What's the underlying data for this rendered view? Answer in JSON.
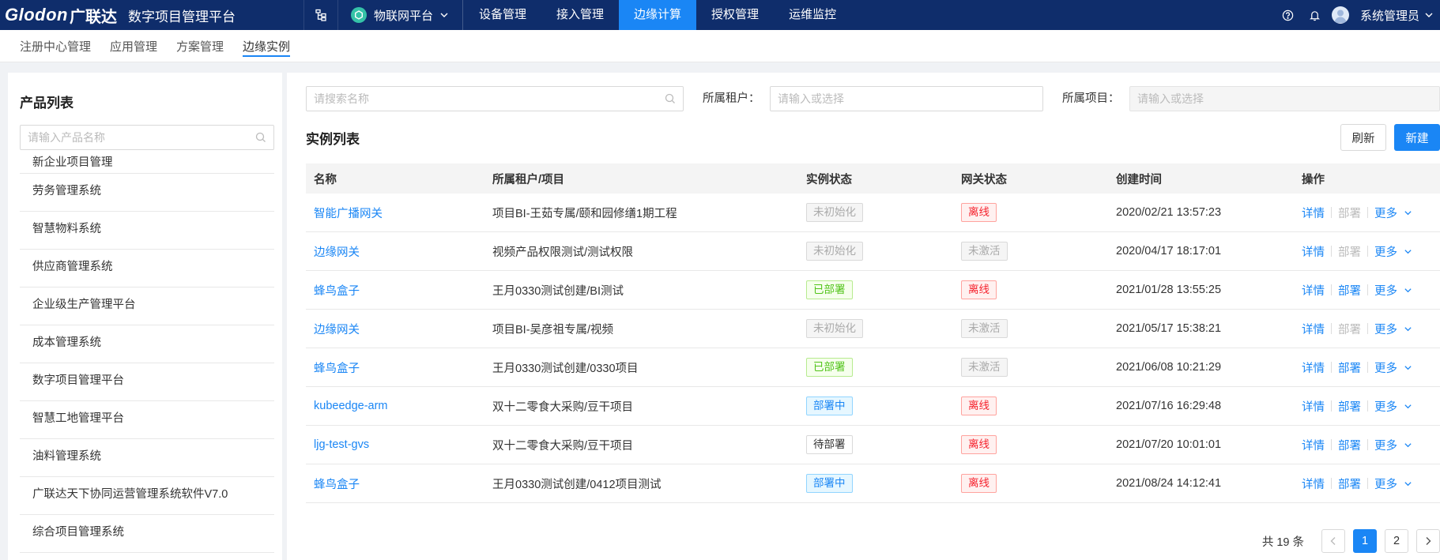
{
  "topbar": {
    "brand": "Glodon",
    "brand_cn": "广联达",
    "platform_title": "数字项目管理平台",
    "iot_menu": "物联网平台",
    "nav": [
      {
        "label": "设备管理",
        "active": false
      },
      {
        "label": "接入管理",
        "active": false
      },
      {
        "label": "边缘计算",
        "active": true
      },
      {
        "label": "授权管理",
        "active": false
      },
      {
        "label": "运维监控",
        "active": false
      }
    ],
    "icons": [
      "org-structure-icon",
      "help-icon",
      "bell-icon",
      "avatar-icon"
    ],
    "user_name": "系统管理员"
  },
  "subnav": {
    "tabs": [
      {
        "label": "注册中心管理",
        "active": false
      },
      {
        "label": "应用管理",
        "active": false
      },
      {
        "label": "方案管理",
        "active": false
      },
      {
        "label": "边缘实例",
        "active": true
      }
    ]
  },
  "left": {
    "title": "产品列表",
    "search_placeholder": "请输入产品名称",
    "products": [
      "新企业项目管理",
      "劳务管理系统",
      "智慧物料系统",
      "供应商管理系统",
      "企业级生产管理平台",
      "成本管理系统",
      "数字项目管理平台",
      "智慧工地管理平台",
      "油料管理系统",
      "广联达天下协同运营管理系统软件V7.0",
      "综合项目管理系统"
    ]
  },
  "filters": {
    "name_placeholder": "请搜索名称",
    "tenant_label": "所属租户：",
    "tenant_placeholder": "请输入或选择",
    "project_label": "所属项目：",
    "project_placeholder": "请输入或选择"
  },
  "section": {
    "title": "实例列表",
    "refresh_label": "刷新",
    "new_label": "新建"
  },
  "table": {
    "headers": [
      "名称",
      "所属租户/项目",
      "实例状态",
      "网关状态",
      "创建时间",
      "操作"
    ],
    "actions": {
      "detail": "详情",
      "deploy": "部署",
      "more": "更多"
    },
    "rows": [
      {
        "name": "智能广播网关",
        "tenant": "项目BI-王茹专属/颐和园修缮1期工程",
        "instance_status": "未初始化",
        "instance_tag": "gray",
        "gateway_status": "离线",
        "gateway_tag": "red",
        "created": "2020/02/21 13:57:23",
        "deploy_enabled": false
      },
      {
        "name": "边缘网关",
        "tenant": "视频产品权限测试/测试权限",
        "instance_status": "未初始化",
        "instance_tag": "gray",
        "gateway_status": "未激活",
        "gateway_tag": "gray",
        "created": "2020/04/17 18:17:01",
        "deploy_enabled": false
      },
      {
        "name": "蜂鸟盒子",
        "tenant": "王月0330测试创建/BI测试",
        "instance_status": "已部署",
        "instance_tag": "green",
        "gateway_status": "离线",
        "gateway_tag": "red",
        "created": "2021/01/28 13:55:25",
        "deploy_enabled": true
      },
      {
        "name": "边缘网关",
        "tenant": "项目BI-吴彦祖专属/视频",
        "instance_status": "未初始化",
        "instance_tag": "gray",
        "gateway_status": "未激活",
        "gateway_tag": "gray",
        "created": "2021/05/17 15:38:21",
        "deploy_enabled": false
      },
      {
        "name": "蜂鸟盒子",
        "tenant": "王月0330测试创建/0330项目",
        "instance_status": "已部署",
        "instance_tag": "green",
        "gateway_status": "未激活",
        "gateway_tag": "gray",
        "created": "2021/06/08 10:21:29",
        "deploy_enabled": true
      },
      {
        "name": "kubeedge-arm",
        "tenant": "双十二零食大采购/豆干项目",
        "instance_status": "部署中",
        "instance_tag": "blue",
        "gateway_status": "离线",
        "gateway_tag": "red",
        "created": "2021/07/16 16:29:48",
        "deploy_enabled": true
      },
      {
        "name": "ljg-test-gvs",
        "tenant": "双十二零食大采购/豆干项目",
        "instance_status": "待部署",
        "instance_tag": "plain",
        "gateway_status": "离线",
        "gateway_tag": "red",
        "created": "2021/07/20 10:01:01",
        "deploy_enabled": true
      },
      {
        "name": "蜂鸟盒子",
        "tenant": "王月0330测试创建/0412项目测试",
        "instance_status": "部署中",
        "instance_tag": "blue",
        "gateway_status": "离线",
        "gateway_tag": "red",
        "created": "2021/08/24 14:12:41",
        "deploy_enabled": true
      }
    ]
  },
  "pagination": {
    "total": "共 19 条",
    "pages": [
      "1",
      "2"
    ],
    "current": "1"
  },
  "colors": {
    "topbar": "#0f2d6b",
    "accent": "#1a86f5"
  }
}
